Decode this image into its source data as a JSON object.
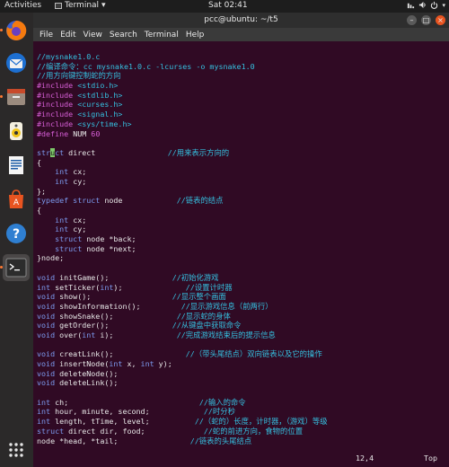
{
  "topbar": {
    "activities": "Activities",
    "app_name": "Terminal",
    "app_menu_arrow": "▾",
    "clock": "Sat 02:41"
  },
  "window": {
    "title": "pcc@ubuntu: ~/t5",
    "minimize": "–",
    "maximize": "□",
    "close": "×"
  },
  "menu": [
    "File",
    "Edit",
    "View",
    "Search",
    "Terminal",
    "Help"
  ],
  "dock": [
    {
      "name": "firefox-icon",
      "color": "#e66000"
    },
    {
      "name": "thunderbird-icon",
      "color": "#1d6fd1"
    },
    {
      "name": "files-icon",
      "color": "#8a7b6e"
    },
    {
      "name": "rhythmbox-icon",
      "color": "#f0c419"
    },
    {
      "name": "writer-icon",
      "color": "#1f5fa8"
    },
    {
      "name": "software-icon",
      "color": "#e95420"
    },
    {
      "name": "help-icon",
      "color": "#2f7fd1"
    },
    {
      "name": "terminal-icon",
      "color": "#2c2c2c"
    },
    {
      "name": "show-apps-icon",
      "color": "#e6e6e6"
    }
  ],
  "code": [
    [
      [
        "c",
        "//mysnake1.0.c"
      ]
    ],
    [
      [
        "c",
        "//编译命令：cc mysnake1.0.c -lcurses -o mysnake1.0"
      ]
    ],
    [
      [
        "c",
        "//用方向键控制蛇的方向"
      ]
    ],
    [
      [
        "p",
        "#include"
      ],
      [
        "c",
        " <stdio.h>"
      ]
    ],
    [
      [
        "p",
        "#include"
      ],
      [
        "c",
        " <stdlib.h>"
      ]
    ],
    [
      [
        "p",
        "#include"
      ],
      [
        "c",
        " <curses.h>"
      ]
    ],
    [
      [
        "p",
        "#include"
      ],
      [
        "c",
        " <signal.h>"
      ]
    ],
    [
      [
        "p",
        "#include"
      ],
      [
        "c",
        " <sys/time.h>"
      ]
    ],
    [
      [
        "p",
        "#define"
      ],
      [
        "t",
        " NUM "
      ],
      [
        "n",
        "60"
      ]
    ],
    [
      [
        "t",
        ""
      ]
    ],
    [
      [
        "k",
        "str"
      ],
      [
        "cur",
        "u"
      ],
      [
        "k",
        "ct"
      ],
      [
        "t",
        " direct                "
      ],
      [
        "c",
        "//用来表示方向的"
      ]
    ],
    [
      [
        "t",
        "{"
      ]
    ],
    [
      [
        "t",
        "    "
      ],
      [
        "k",
        "int"
      ],
      [
        "t",
        " cx;"
      ]
    ],
    [
      [
        "t",
        "    "
      ],
      [
        "k",
        "int"
      ],
      [
        "t",
        " cy;"
      ]
    ],
    [
      [
        "t",
        "};"
      ]
    ],
    [
      [
        "k",
        "typedef struct"
      ],
      [
        "t",
        " node            "
      ],
      [
        "c",
        "//链表的结点"
      ]
    ],
    [
      [
        "t",
        "{"
      ]
    ],
    [
      [
        "t",
        "    "
      ],
      [
        "k",
        "int"
      ],
      [
        "t",
        " cx;"
      ]
    ],
    [
      [
        "t",
        "    "
      ],
      [
        "k",
        "int"
      ],
      [
        "t",
        " cy;"
      ]
    ],
    [
      [
        "t",
        "    "
      ],
      [
        "k",
        "struct"
      ],
      [
        "t",
        " node *back;"
      ]
    ],
    [
      [
        "t",
        "    "
      ],
      [
        "k",
        "struct"
      ],
      [
        "t",
        " node *next;"
      ]
    ],
    [
      [
        "t",
        "}node;"
      ]
    ],
    [
      [
        "t",
        ""
      ]
    ],
    [
      [
        "k",
        "void"
      ],
      [
        "t",
        " initGame();              "
      ],
      [
        "c",
        "//初始化游戏"
      ]
    ],
    [
      [
        "k",
        "int"
      ],
      [
        "t",
        " setTicker("
      ],
      [
        "k",
        "int"
      ],
      [
        "t",
        ");              "
      ],
      [
        "c",
        "//设置计时器"
      ]
    ],
    [
      [
        "k",
        "void"
      ],
      [
        "t",
        " show();                  "
      ],
      [
        "c",
        "//显示整个画面"
      ]
    ],
    [
      [
        "k",
        "void"
      ],
      [
        "t",
        " showInformation();         "
      ],
      [
        "c",
        "//显示游戏信息（前两行）"
      ]
    ],
    [
      [
        "k",
        "void"
      ],
      [
        "t",
        " showSnake();              "
      ],
      [
        "c",
        "//显示蛇的身体"
      ]
    ],
    [
      [
        "k",
        "void"
      ],
      [
        "t",
        " getOrder();              "
      ],
      [
        "c",
        "//从键盘中获取命令"
      ]
    ],
    [
      [
        "k",
        "void"
      ],
      [
        "t",
        " over("
      ],
      [
        "k",
        "int"
      ],
      [
        "t",
        " i);              "
      ],
      [
        "c",
        "//完成游戏结束后的提示信息"
      ]
    ],
    [
      [
        "t",
        ""
      ]
    ],
    [
      [
        "k",
        "void"
      ],
      [
        "t",
        " creatLink();                "
      ],
      [
        "c",
        "//（带头尾结点）双向链表以及它的操作"
      ]
    ],
    [
      [
        "k",
        "void"
      ],
      [
        "t",
        " insertNode("
      ],
      [
        "k",
        "int"
      ],
      [
        "t",
        " x, "
      ],
      [
        "k",
        "int"
      ],
      [
        "t",
        " y);"
      ]
    ],
    [
      [
        "k",
        "void"
      ],
      [
        "t",
        " deleteNode();"
      ]
    ],
    [
      [
        "k",
        "void"
      ],
      [
        "t",
        " deleteLink();"
      ]
    ],
    [
      [
        "t",
        ""
      ]
    ],
    [
      [
        "k",
        "int"
      ],
      [
        "t",
        " ch;                             "
      ],
      [
        "c",
        "//输入的命令"
      ]
    ],
    [
      [
        "k",
        "int"
      ],
      [
        "t",
        " hour, minute, second;            "
      ],
      [
        "c",
        "//时分秒"
      ]
    ],
    [
      [
        "k",
        "int"
      ],
      [
        "t",
        " length, tTime, level;          "
      ],
      [
        "c",
        "//（蛇的）长度，计时器，（游戏）等级"
      ]
    ],
    [
      [
        "k",
        "struct"
      ],
      [
        "t",
        " direct dir, food;             "
      ],
      [
        "c",
        "//蛇的前进方向，食物的位置"
      ]
    ],
    [
      [
        "t",
        "node *head, *tail;                "
      ],
      [
        "c",
        "//链表的头尾结点"
      ]
    ]
  ],
  "status": {
    "position": "12,4",
    "scroll": "Top"
  }
}
